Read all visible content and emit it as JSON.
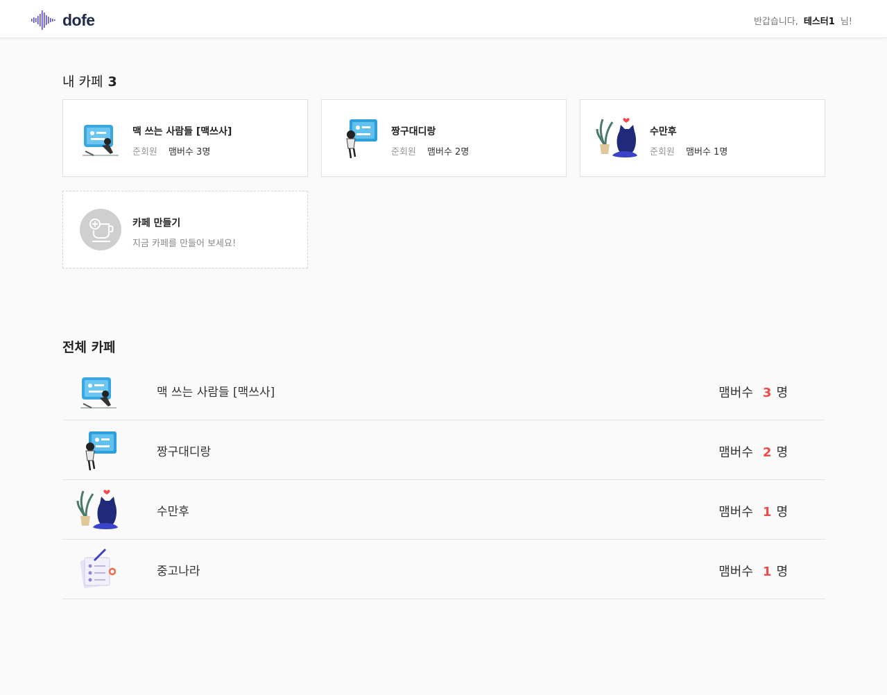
{
  "header": {
    "brand": "dofe",
    "greeting_prefix": "반갑습니다,",
    "user_name": "테스터1",
    "greeting_suffix": "님!",
    "accent_color": "#5b4bd6"
  },
  "my_cafes": {
    "title": "내 카페",
    "count": "3",
    "cards": [
      {
        "name": "맥 쓰는 사람들 [맥쓰사]",
        "role": "준회원",
        "members": "맴버수 3명",
        "icon": "mac-user-illustration"
      },
      {
        "name": "짱구대디랑",
        "role": "준회원",
        "members": "맴버수 2명",
        "icon": "board-user-illustration"
      },
      {
        "name": "수만후",
        "role": "준회원",
        "members": "맴버수 1명",
        "icon": "cat-plant-illustration"
      }
    ],
    "create": {
      "title": "카페 만들기",
      "description": "지금 카페를 만들어 보세요!",
      "icon": "add-cup-icon"
    }
  },
  "all_cafes": {
    "title": "전체 카페",
    "member_label": "맴버수",
    "unit": "명",
    "rows": [
      {
        "name": "맥 쓰는 사람들 [맥쓰사]",
        "count": "3",
        "icon": "mac-user-illustration"
      },
      {
        "name": "짱구대디랑",
        "count": "2",
        "icon": "board-user-illustration"
      },
      {
        "name": "수만후",
        "count": "1",
        "icon": "cat-plant-illustration"
      },
      {
        "name": "중고나라",
        "count": "1",
        "icon": "checklist-illustration"
      }
    ]
  }
}
